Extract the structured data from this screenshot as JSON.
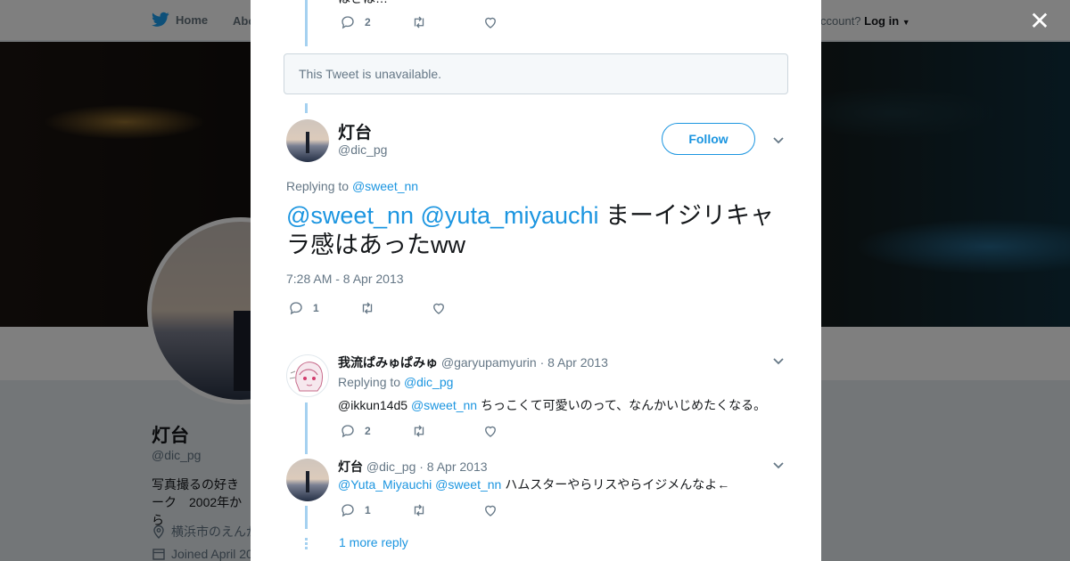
{
  "topbar": {
    "home_label": "Home",
    "about_label": "Abo",
    "account_prompt": "ccount?",
    "login_label": "Log in"
  },
  "profile": {
    "name": "灯台",
    "handle": "@dic_pg",
    "bio_line1": "写真撮るの好き",
    "bio_line2": "ーク　2002年から",
    "location": "横浜市のえんが",
    "joined": "Joined April 20"
  },
  "modal": {
    "top_tweet": {
      "partial_text": "はさは…",
      "reply_count": "2"
    },
    "unavailable_text": "This Tweet is unavailable.",
    "main_tweet": {
      "name": "灯台",
      "handle": "@dic_pg",
      "follow_label": "Follow",
      "replying_prefix": "Replying to",
      "replying_to": "@sweet_nn",
      "mention1": "@sweet_nn",
      "mention2": "@yuta_miyauchi",
      "text": "まーイジリキャラ感はあったww",
      "timestamp": "7:28 AM - 8 Apr 2013",
      "reply_count": "1"
    },
    "replies": [
      {
        "name": "我流ぱみゅぱみゅ",
        "handle": "@garyupamyurin",
        "date": "· 8 Apr 2013",
        "replying_prefix": "Replying to",
        "replying_to": "@dic_pg",
        "mention_plain": "@ikkun14d5",
        "mention_link": "@sweet_nn",
        "text": "ちっこくて可愛いのって、なんかいじめたくなる。",
        "reply_count": "2"
      },
      {
        "name": "灯台",
        "handle": "@dic_pg",
        "date": "· 8 Apr 2013",
        "mention1": "@Yuta_Miyauchi",
        "mention2": "@sweet_nn",
        "text": "ハムスターやらリスやらイジメんなよ←",
        "reply_count": "1"
      }
    ],
    "more_replies": "1 more reply"
  },
  "colors": {
    "link": "#1b95e0",
    "muted": "#657786",
    "thread_line": "#a5d1f0",
    "overlay": "rgba(0,0,0,0.5)"
  },
  "icons": [
    "twitter-bird-icon",
    "reply-icon",
    "retweet-icon",
    "heart-icon",
    "chevron-down-icon",
    "close-icon",
    "location-icon",
    "calendar-icon"
  ]
}
